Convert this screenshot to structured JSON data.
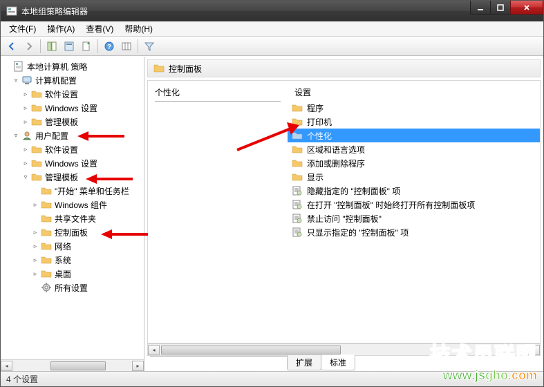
{
  "window": {
    "title": "本地组策略编辑器"
  },
  "menu": {
    "file": "文件(F)",
    "action": "操作(A)",
    "view": "查看(V)",
    "help": "帮助(H)"
  },
  "toolbar": {
    "back": "back",
    "forward": "forward",
    "up": "up",
    "show_hide_tree": "show-tree",
    "properties": "properties",
    "export": "export",
    "help": "help",
    "columns": "columns",
    "filter": "filter"
  },
  "tree": [
    {
      "label": "本地计算机 策略",
      "indent": 0,
      "icon": "policy",
      "expander": ""
    },
    {
      "label": "计算机配置",
      "indent": 1,
      "icon": "computer",
      "expander": "▾"
    },
    {
      "label": "软件设置",
      "indent": 2,
      "icon": "folder",
      "expander": "▸"
    },
    {
      "label": "Windows 设置",
      "indent": 2,
      "icon": "folder",
      "expander": "▸"
    },
    {
      "label": "管理模板",
      "indent": 2,
      "icon": "folder",
      "expander": "▸"
    },
    {
      "label": "用户配置",
      "indent": 1,
      "icon": "user",
      "expander": "▾"
    },
    {
      "label": "软件设置",
      "indent": 2,
      "icon": "folder",
      "expander": "▸"
    },
    {
      "label": "Windows 设置",
      "indent": 2,
      "icon": "folder",
      "expander": "▸"
    },
    {
      "label": "管理模板",
      "indent": 2,
      "icon": "folder",
      "expander": "▾"
    },
    {
      "label": "\"开始\" 菜单和任务栏",
      "indent": 3,
      "icon": "folder",
      "expander": ""
    },
    {
      "label": "Windows 组件",
      "indent": 3,
      "icon": "folder",
      "expander": "▸"
    },
    {
      "label": "共享文件夹",
      "indent": 3,
      "icon": "folder",
      "expander": ""
    },
    {
      "label": "控制面板",
      "indent": 3,
      "icon": "folder",
      "expander": "▸"
    },
    {
      "label": "网络",
      "indent": 3,
      "icon": "folder",
      "expander": "▸"
    },
    {
      "label": "系统",
      "indent": 3,
      "icon": "folder",
      "expander": "▸"
    },
    {
      "label": "桌面",
      "indent": 3,
      "icon": "folder",
      "expander": "▸"
    },
    {
      "label": "所有设置",
      "indent": 3,
      "icon": "settings",
      "expander": ""
    }
  ],
  "content": {
    "header": "控制面板",
    "category_title": "个性化",
    "settings_header": "设置",
    "items": [
      {
        "label": "程序",
        "icon": "folder",
        "selected": false
      },
      {
        "label": "打印机",
        "icon": "folder",
        "selected": false
      },
      {
        "label": "个性化",
        "icon": "folder",
        "selected": true
      },
      {
        "label": "区域和语言选项",
        "icon": "folder",
        "selected": false
      },
      {
        "label": "添加或删除程序",
        "icon": "folder",
        "selected": false
      },
      {
        "label": "显示",
        "icon": "folder",
        "selected": false
      },
      {
        "label": "隐藏指定的 \"控制面板\" 项",
        "icon": "setting",
        "selected": false
      },
      {
        "label": "在打开 \"控制面板\" 时始终打开所有控制面板项",
        "icon": "setting",
        "selected": false
      },
      {
        "label": "禁止访问 \"控制面板\"",
        "icon": "setting",
        "selected": false
      },
      {
        "label": "只显示指定的 \"控制面板\" 项",
        "icon": "setting",
        "selected": false
      }
    ]
  },
  "tabs": {
    "extended": "扩展",
    "standard": "标准"
  },
  "status": {
    "text": "4 个设置"
  },
  "watermark": {
    "cn": "技术员联盟",
    "url_1": "www.js",
    "url_g": "gho",
    "url_c": ".com"
  }
}
